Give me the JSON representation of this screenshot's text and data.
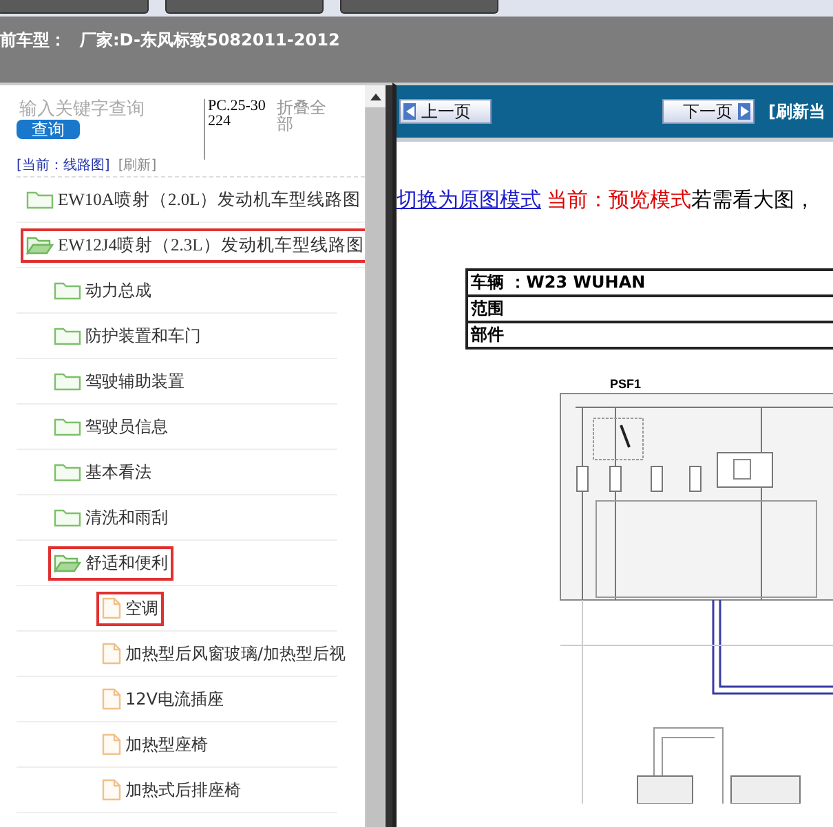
{
  "header": {
    "label": "前车型：",
    "model": "厂家:D-东风标致5082011-2012"
  },
  "sidebar": {
    "search": {
      "placeholder": "输入关键字查询",
      "button": "查询"
    },
    "code": "PC.25-30224",
    "collapse_all": "折叠全部",
    "breadcrumb": "[当前：线路图]",
    "refresh": "[刷新]",
    "tree": [
      {
        "label": "EW10A喷射（2.0L）发动机车型线路图",
        "kind": "folder",
        "expanded": false,
        "outlined": false
      },
      {
        "label": "EW12J4喷射（2.3L）发动机车型线路图",
        "kind": "folder",
        "expanded": true,
        "outlined": true,
        "children": [
          {
            "label": "动力总成",
            "kind": "folder",
            "expanded": false,
            "outlined": false
          },
          {
            "label": "防护装置和车门",
            "kind": "folder",
            "expanded": false,
            "outlined": false
          },
          {
            "label": "驾驶辅助装置",
            "kind": "folder",
            "expanded": false,
            "outlined": false
          },
          {
            "label": "驾驶员信息",
            "kind": "folder",
            "expanded": false,
            "outlined": false
          },
          {
            "label": "基本看法",
            "kind": "folder",
            "expanded": false,
            "outlined": false
          },
          {
            "label": "清洗和雨刮",
            "kind": "folder",
            "expanded": false,
            "outlined": false
          },
          {
            "label": "舒适和便利",
            "kind": "folder",
            "expanded": true,
            "outlined": true,
            "children": [
              {
                "label": "空调",
                "kind": "file",
                "outlined": true
              },
              {
                "label": "加热型后风窗玻璃/加热型后视",
                "kind": "file",
                "outlined": false
              },
              {
                "label": "12V电流插座",
                "kind": "file",
                "outlined": false
              },
              {
                "label": "加热型座椅",
                "kind": "file",
                "outlined": false
              },
              {
                "label": "加热式后排座椅",
                "kind": "file",
                "outlined": false
              }
            ]
          }
        ]
      }
    ]
  },
  "viewer": {
    "prev": "上一页",
    "next": "下一页",
    "refresh": "[刷新当",
    "mode_link": "切换为原图模式",
    "mode_status": "当前：预览模式",
    "hint": "若需看大图，",
    "sheet": {
      "rows": [
        "车辆 ：W23 WUHAN",
        "范围",
        "部件"
      ],
      "diagram_title": "PSF1"
    }
  }
}
